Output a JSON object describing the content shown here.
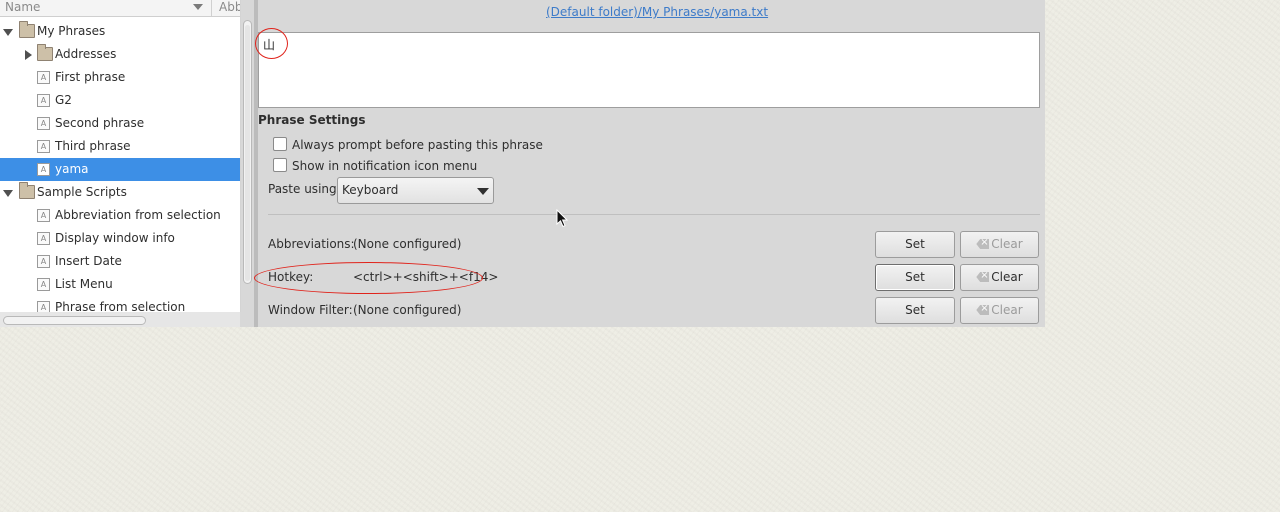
{
  "tree": {
    "columns": {
      "name": "Name",
      "abbreviation": "Abb"
    },
    "items": [
      {
        "label": "My Phrases",
        "kind": "folder",
        "level": 0,
        "expanded": true
      },
      {
        "label": "Addresses",
        "kind": "folder",
        "level": 1,
        "expanded": false
      },
      {
        "label": "First phrase",
        "kind": "phrase",
        "level": 1
      },
      {
        "label": "G2",
        "kind": "phrase",
        "level": 1
      },
      {
        "label": "Second phrase",
        "kind": "phrase",
        "level": 1
      },
      {
        "label": "Third phrase",
        "kind": "phrase",
        "level": 1
      },
      {
        "label": "yama",
        "kind": "phrase",
        "level": 1,
        "selected": true
      },
      {
        "label": "Sample Scripts",
        "kind": "folder",
        "level": 0,
        "expanded": true
      },
      {
        "label": "Abbreviation from selection",
        "kind": "phrase",
        "level": 1
      },
      {
        "label": "Display window info",
        "kind": "phrase",
        "level": 1
      },
      {
        "label": "Insert Date",
        "kind": "phrase",
        "level": 1
      },
      {
        "label": "List Menu",
        "kind": "phrase",
        "level": 1
      },
      {
        "label": "Phrase from selection",
        "kind": "phrase",
        "level": 1
      }
    ]
  },
  "editor": {
    "file_path": "(Default folder)/My Phrases/yama.txt",
    "phrase_text": "山",
    "settings_title": "Phrase Settings",
    "prompt_before_paste": {
      "label": "Always prompt before pasting this phrase",
      "checked": false
    },
    "show_in_tray": {
      "label": "Show in notification icon menu",
      "checked": false
    },
    "paste_using": {
      "label": "Paste using",
      "value": "Keyboard"
    },
    "abbreviations": {
      "label": "Abbreviations:",
      "value": "(None configured)",
      "set_label": "Set",
      "clear_label": "Clear"
    },
    "hotkey": {
      "label": "Hotkey:",
      "value": "<ctrl>+<shift>+<f14>",
      "set_label": "Set",
      "clear_label": "Clear"
    },
    "window_filter": {
      "label": "Window Filter:",
      "value": "(None configured)",
      "set_label": "Set",
      "clear_label": "Clear"
    }
  },
  "colors": {
    "selection": "#3d8fe6",
    "link": "#3d7bc9",
    "annotation": "#e0231b",
    "panel": "#d8d8d8",
    "desktop": "#eeede4"
  }
}
